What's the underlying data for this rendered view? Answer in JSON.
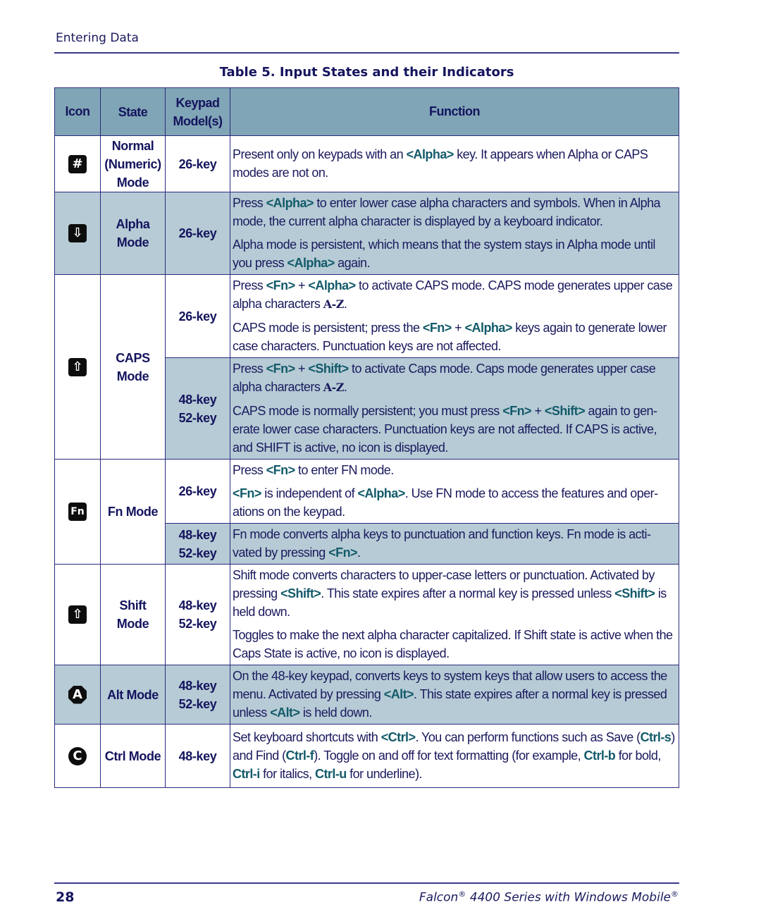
{
  "header": {
    "running_head": "Entering Data"
  },
  "table": {
    "title": "Table 5. Input States and their Indicators",
    "columns": [
      "Icon",
      "State",
      "Keypad Model(s)",
      "Function"
    ],
    "column_header_keypad_line1": "Keypad",
    "column_header_keypad_line2": "Model(s)",
    "rows": [
      {
        "icon": "numeric-mode-icon",
        "icon_glyph": "#",
        "state_lines": [
          "Normal",
          "(Numeric)",
          "Mode"
        ],
        "keypads": [
          {
            "models": [
              "26-key"
            ],
            "shaded": false,
            "function_html": "<p>Present only on keypads with an <span class=\"k\">&lt;Alpha&gt;</span> key. It appears when Alpha or CAPS modes are not on.</p>"
          }
        ]
      },
      {
        "icon": "alpha-mode-icon",
        "icon_glyph": "⇩",
        "state_lines": [
          "Alpha",
          "Mode"
        ],
        "shaded": true,
        "keypads": [
          {
            "models": [
              "26-key"
            ],
            "shaded": true,
            "function_html": "<p>Press <span class=\"k\">&lt;Alpha&gt;</span> to enter lower case alpha characters and symbols. When in Alpha mode, the current alpha character is displayed by a keyboard indicator.</p><p>Alpha mode is persistent, which means that the system stays in Alpha mode until you press <span class=\"k\">&lt;Alpha&gt;</span> again.</p>"
          }
        ]
      },
      {
        "icon": "caps-mode-icon",
        "icon_glyph": "⇧",
        "state_lines": [
          "CAPS",
          "Mode"
        ],
        "keypads": [
          {
            "models": [
              "26-key"
            ],
            "shaded": false,
            "function_html": "<p>Press <span class=\"k\">&lt;Fn&gt;</span> + <span class=\"k\">&lt;Alpha&gt;</span> to activate CAPS mode. CAPS mode generates upper case alpha characters <span class=\"mono\">A-Z</span>.</p><p>CAPS mode is persistent; press the <span class=\"k\">&lt;Fn&gt;</span> + <span class=\"k\">&lt;Alpha&gt;</span> keys again to generate lower case characters. Punctuation keys are not affected.</p>"
          },
          {
            "models": [
              "48-key",
              "52-key"
            ],
            "shaded": true,
            "function_html": "<p>Press <span class=\"k\">&lt;Fn&gt;</span> + <span class=\"k\">&lt;Shift&gt;</span> to activate Caps mode. Caps mode generates upper case alpha characters <span class=\"mono\">A-Z</span>.</p><p>CAPS mode is normally persistent; you must press <span class=\"k\">&lt;Fn&gt;</span> + <span class=\"k\">&lt;Shift&gt;</span> again to gen-erate lower case characters. Punctuation keys are not affected. If CAPS is active, and SHIFT is active, no icon is displayed.</p>"
          }
        ]
      },
      {
        "icon": "fn-mode-icon",
        "icon_glyph": "Fn",
        "state_lines": [
          "Fn Mode"
        ],
        "keypads": [
          {
            "models": [
              "26-key"
            ],
            "shaded": false,
            "function_html": "<p>Press <span class=\"k\">&lt;Fn&gt;</span> to enter FN mode.</p><p><span class=\"k\">&lt;Fn&gt;</span> is independent of <span class=\"k\">&lt;Alpha&gt;</span>. Use FN mode to access the features and oper-ations on the keypad.</p>"
          },
          {
            "models": [
              "48-key",
              "52-key"
            ],
            "shaded": true,
            "function_html": "<p>Fn mode converts alpha keys to punctuation and function keys. Fn mode is acti-vated by pressing <span class=\"k\">&lt;Fn&gt;</span>.</p>"
          }
        ]
      },
      {
        "icon": "shift-mode-icon",
        "icon_glyph": "⇧",
        "state_lines": [
          "Shift",
          "Mode"
        ],
        "keypads": [
          {
            "models": [
              "48-key",
              "52-key"
            ],
            "shaded": false,
            "function_html": "<p>Shift mode converts characters to upper-case letters or punctuation. Activated by pressing <span class=\"k\">&lt;Shift&gt;</span>. This state expires after a normal key is pressed unless <span class=\"k\">&lt;Shift&gt;</span> is held down.</p><p>Toggles to make the next alpha character capitalized. If Shift state is active when the Caps State is active, no icon is displayed.</p>"
          }
        ]
      },
      {
        "icon": "alt-mode-icon",
        "icon_glyph": "A",
        "state_lines": [
          "Alt Mode"
        ],
        "shaded": true,
        "keypads": [
          {
            "models": [
              "48-key",
              "52-key"
            ],
            "shaded": true,
            "function_html": "<p>On the 48-key keypad, converts keys to system keys that allow users to access the menu. Activated by pressing <span class=\"k\">&lt;Alt&gt;</span>. This state expires after a normal key is pressed unless <span class=\"k\">&lt;Alt&gt;</span> is held down.</p>"
          }
        ]
      },
      {
        "icon": "ctrl-mode-icon",
        "icon_glyph": "C",
        "state_lines": [
          "Ctrl Mode"
        ],
        "keypads": [
          {
            "models": [
              "48-key"
            ],
            "shaded": false,
            "function_html": "<p>Set keyboard shortcuts with <span class=\"k\">&lt;Ctrl&gt;</span>. You can perform functions such as Save (<span class=\"k\">Ctrl-s</span>) and Find (<span class=\"k\">Ctrl-f</span>). Toggle on and off for text formatting (for example, <span class=\"k\">Ctrl-b</span> for bold, <span class=\"k\">Ctrl-i</span> for italics, <span class=\"k\">Ctrl-u</span> for underline).</p>"
          }
        ]
      }
    ]
  },
  "footer": {
    "page_number": "28",
    "book_title_parts": [
      "Falcon",
      "®",
      " 4400 Series with Windows Mobile",
      "®"
    ]
  },
  "colors": {
    "header_fill": "#80a5b6",
    "shaded_row": "#b6cbd5",
    "key_text": "#135a6a",
    "text": "#1a1a5e",
    "rule": "#2b2b7e"
  }
}
